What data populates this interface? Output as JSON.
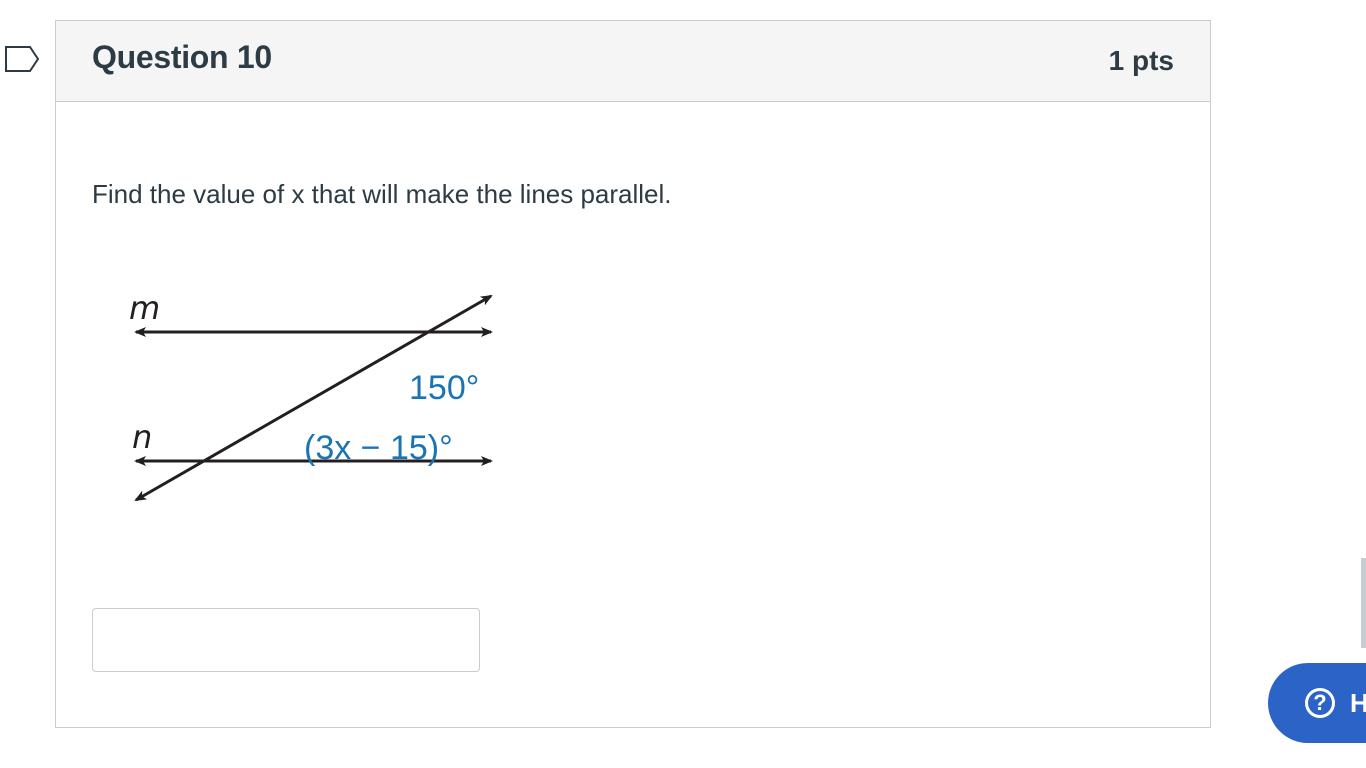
{
  "question": {
    "title": "Question 10",
    "points": "1 pts",
    "prompt": "Find the value of x that will make the lines parallel.",
    "diagram": {
      "line_m_label": "m",
      "line_n_label": "n",
      "angle_1_label": "150°",
      "angle_2_label": "(3x − 15)°",
      "label_color": "#1a73b5"
    },
    "answer": {
      "value": "",
      "placeholder": ""
    }
  },
  "help": {
    "icon": "question-circle-icon",
    "label": "H"
  }
}
